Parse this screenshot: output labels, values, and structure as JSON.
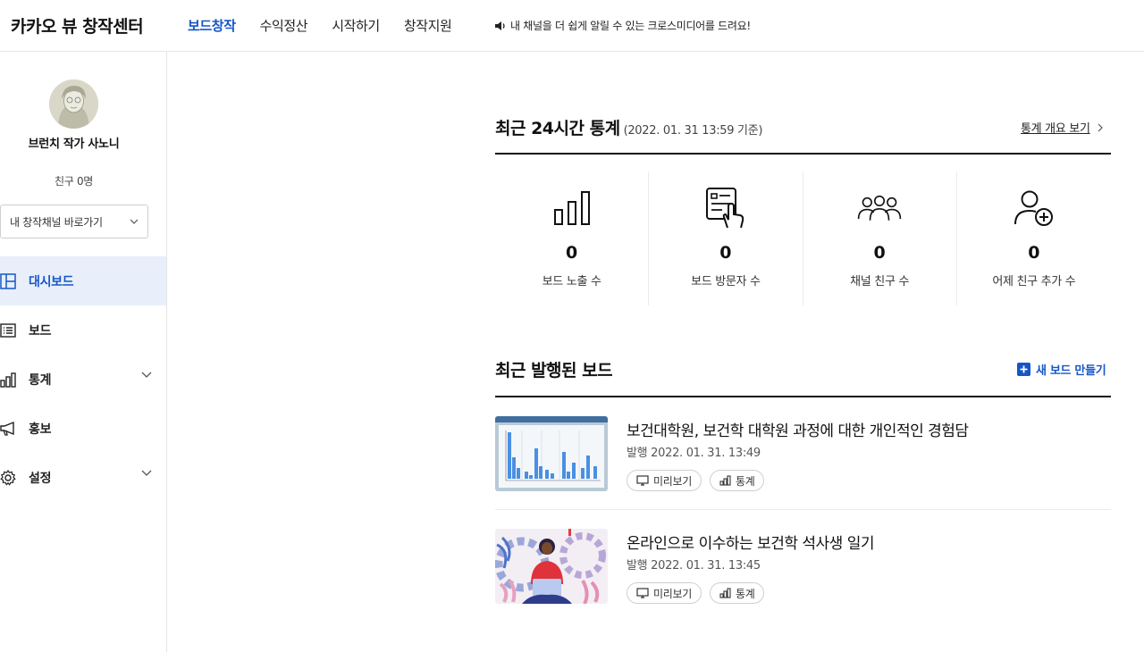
{
  "header": {
    "logo": "카카오 뷰 창작센터",
    "nav": [
      "보드창작",
      "수익정산",
      "시작하기",
      "창작지원"
    ],
    "notice": "내 채널을 더 쉽게 알릴 수 있는 크로스미디어를 드려요!"
  },
  "profile": {
    "name": "브런치 작가 사노니",
    "friends": "친구 0명",
    "channel_select": "내 창작채널 바로가기"
  },
  "menu": [
    {
      "label": "대시보드",
      "icon": "dashboard-icon"
    },
    {
      "label": "보드",
      "icon": "list-icon"
    },
    {
      "label": "통계",
      "icon": "bar-chart-icon"
    },
    {
      "label": "홍보",
      "icon": "megaphone-icon"
    },
    {
      "label": "설정",
      "icon": "gear-icon"
    }
  ],
  "stats_section": {
    "title": "최근 24시간 통계",
    "subtitle": "(2022. 01. 31 13:59 기준)",
    "link": "통계 개요 보기",
    "items": [
      {
        "value": "0",
        "label": "보드 노출 수",
        "icon": "bar-chart-icon"
      },
      {
        "value": "0",
        "label": "보드 방문자 수",
        "icon": "tap-document-icon"
      },
      {
        "value": "0",
        "label": "채널 친구 수",
        "icon": "group-icon"
      },
      {
        "value": "0",
        "label": "어제 친구 추가 수",
        "icon": "add-user-icon"
      }
    ]
  },
  "boards_section": {
    "title": "최근 발행된 보드",
    "new_board": "새 보드 만들기",
    "posts": [
      {
        "title": "보건대학원, 보건학 대학원 과정에 대한 개인적인 경험담",
        "date": "발행 2022. 01. 31. 13:49",
        "preview": "미리보기",
        "stats": "통계"
      },
      {
        "title": "온라인으로 이수하는 보건학 석사생 일기",
        "date": "발행 2022. 01. 31. 13:45",
        "preview": "미리보기",
        "stats": "통계"
      }
    ]
  },
  "colors": {
    "accent": "#1556c7",
    "active_bg": "#e8effb"
  }
}
